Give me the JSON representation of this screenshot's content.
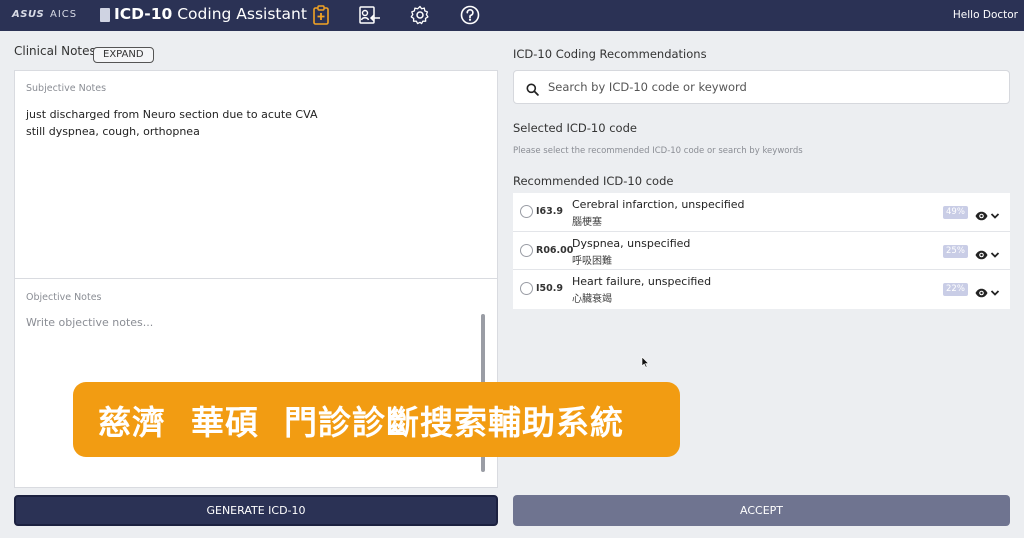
{
  "header": {
    "brand_left": "ASUS",
    "brand_right": "AICS",
    "app_title_bold": "ICD-10",
    "app_title_rest": " Coding Assistant",
    "greeting": "Hello Doctor",
    "nav_icons": [
      "clipboard-plus-icon",
      "patient-transfer-icon",
      "gear-icon",
      "help-icon"
    ]
  },
  "left": {
    "section_title": "Clinical Notes",
    "expand_label": "EXPAND",
    "subjective": {
      "label": "Subjective Notes",
      "line1": "just discharged from Neuro section due to acute CVA",
      "line2": "still dyspnea, cough, orthopnea"
    },
    "objective": {
      "label": "Objective Notes",
      "placeholder": "Write objective notes..."
    },
    "generate_label": "GENERATE ICD-10"
  },
  "right": {
    "section_title": "ICD-10 Coding Recommendations",
    "search_placeholder": "Search by ICD-10 code or keyword",
    "selected_title": "Selected ICD-10 code",
    "selected_hint": "Please select the recommended ICD-10 code or search by keywords",
    "recommended_title": "Recommended ICD-10 code",
    "items": [
      {
        "code": "I63.9",
        "name": "Cerebral infarction, unspecified",
        "cname": "腦梗塞",
        "pct": "49%"
      },
      {
        "code": "R06.00",
        "name": "Dyspnea, unspecified",
        "cname": "呼吸困難",
        "pct": "25%"
      },
      {
        "code": "I50.9",
        "name": "Heart failure, unspecified",
        "cname": "心臟衰竭",
        "pct": "22%"
      }
    ],
    "accept_label": "ACCEPT"
  },
  "banner": {
    "text": "慈濟  華碩  門診診斷搜索輔助系統"
  },
  "colors": {
    "header_bg": "#2b3255",
    "banner_bg": "#f29c12",
    "accept_bg": "#6f7490",
    "pct_badge": "#c9cde6"
  }
}
